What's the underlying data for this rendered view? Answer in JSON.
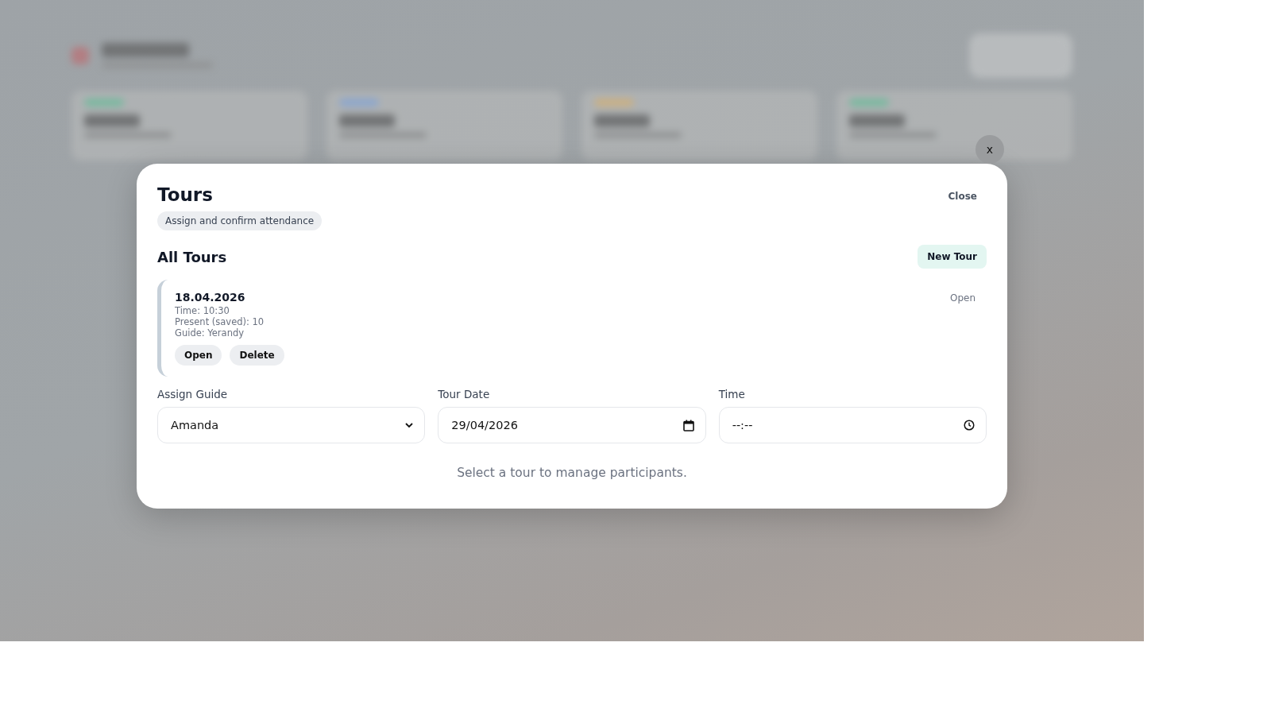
{
  "dialog": {
    "title": "Tours",
    "subtitle": "Assign and confirm attendance",
    "close_label": "Close",
    "dismiss_label": "x"
  },
  "tours_section": {
    "heading": "All Tours",
    "new_button": "New Tour"
  },
  "tours": [
    {
      "date": "18.04.2026",
      "details": [
        "Time: 10:30",
        "Present (saved): 10",
        "Guide: Yerandy"
      ],
      "status": "Open",
      "actions": [
        "Open",
        "Delete"
      ]
    }
  ],
  "form": [
    {
      "kind": "select",
      "label": "Assign Guide",
      "value": "Amanda"
    },
    {
      "kind": "date",
      "label": "Tour Date",
      "value": "29/04/2026"
    },
    {
      "kind": "time",
      "label": "Time",
      "value": "--:--"
    }
  ],
  "empty_message": "Select a tour to manage participants."
}
